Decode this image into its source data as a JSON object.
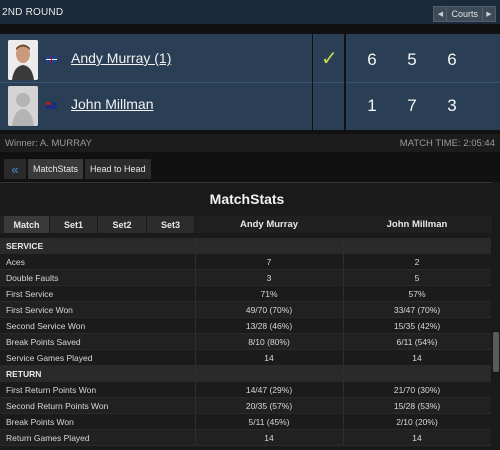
{
  "round": {
    "label": "2ND ROUND"
  },
  "courts": {
    "label": "Courts",
    "prev_icon": "chevron-left-icon",
    "next_icon": "chevron-right-icon"
  },
  "players": [
    {
      "name": "Andy Murray (1)",
      "flag": "gb-flag",
      "scores": [
        "6",
        "5",
        "6"
      ],
      "winner": true
    },
    {
      "name": "John Millman",
      "flag": "au-flag",
      "scores": [
        "1",
        "7",
        "3"
      ],
      "winner": false
    }
  ],
  "result": {
    "winner": "Winner: A. MURRAY",
    "match_time": "MATCH TIME: 2:05:44"
  },
  "tabs": {
    "back_icon": "double-chevron-left-icon",
    "items": [
      "MatchStats",
      "Head to Head"
    ]
  },
  "panel": {
    "title": "MatchStats",
    "set_tabs": [
      "Match",
      "Set1",
      "Set2",
      "Set3"
    ],
    "columns": [
      "Andy Murray",
      "John Millman"
    ]
  },
  "stats": [
    {
      "label": "SERVICE",
      "section": true,
      "v1": "",
      "v2": ""
    },
    {
      "label": "Aces",
      "v1": "7",
      "v2": "2"
    },
    {
      "label": "Double Faults",
      "v1": "3",
      "v2": "5"
    },
    {
      "label": "First Service",
      "v1": "71%",
      "v2": "57%"
    },
    {
      "label": "First Service Won",
      "v1": "49/70 (70%)",
      "v2": "33/47 (70%)"
    },
    {
      "label": "Second Service Won",
      "v1": "13/28 (46%)",
      "v2": "15/35 (42%)"
    },
    {
      "label": "Break Points Saved",
      "v1": "8/10 (80%)",
      "v2": "6/11 (54%)"
    },
    {
      "label": "Service Games Played",
      "v1": "14",
      "v2": "14"
    },
    {
      "label": "RETURN",
      "section": true,
      "v1": "",
      "v2": ""
    },
    {
      "label": "First Return Points Won",
      "v1": "14/47 (29%)",
      "v2": "21/70 (30%)"
    },
    {
      "label": "Second Return Points Won",
      "v1": "20/35 (57%)",
      "v2": "15/28 (53%)"
    },
    {
      "label": "Break Points Won",
      "v1": "5/11 (45%)",
      "v2": "2/10 (20%)"
    },
    {
      "label": "Return Games Played",
      "v1": "14",
      "v2": "14"
    }
  ]
}
